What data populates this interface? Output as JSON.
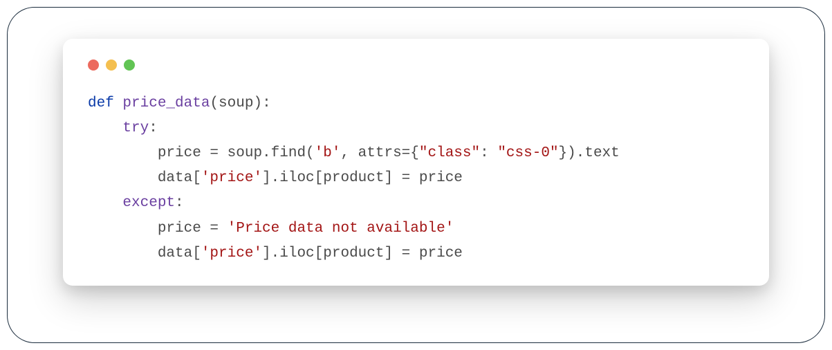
{
  "colors": {
    "border": "#1a2b3c",
    "dot_red": "#ec6a5e",
    "dot_yellow": "#f4bf4f",
    "dot_green": "#61c454",
    "keyword": "#0a3aa8",
    "function": "#6a3fa0",
    "string": "#a31515",
    "text": "#4a4a4a"
  },
  "code": {
    "line1": {
      "def": "def",
      "fn": "price_data",
      "params": "(soup):"
    },
    "line2": {
      "try": "try",
      "colon": ":"
    },
    "line3": {
      "pre": "        price = soup.find(",
      "s1": "'b'",
      "mid": ", attrs={",
      "s2": "\"class\"",
      "col": ": ",
      "s3": "\"css-0\"",
      "post": "}).text"
    },
    "line4": {
      "pre": "        data[",
      "s1": "'price'",
      "post": "].iloc[product] = price"
    },
    "line5": {
      "except": "except",
      "colon": ":"
    },
    "line6": {
      "pre": "        price = ",
      "s1": "'Price data not available'"
    },
    "line7": {
      "pre": "        data[",
      "s1": "'price'",
      "post": "].iloc[product] = price"
    }
  }
}
